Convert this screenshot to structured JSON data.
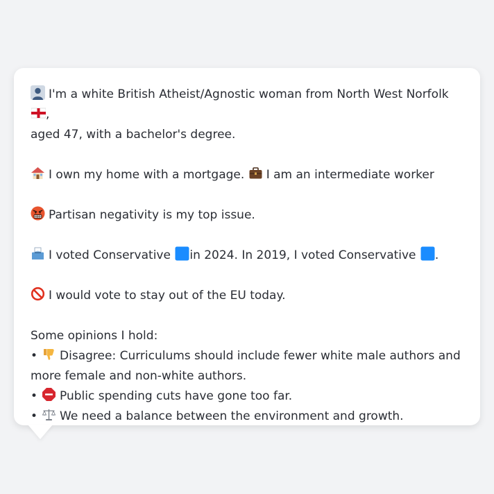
{
  "profile": {
    "identity": {
      "icon": "person-silhouette-icon",
      "text": "I'm a white British Atheist/Agnostic woman from North West Norfolk",
      "flag_icon": "england-flag-icon",
      "suffix": ",",
      "line2": "aged 47, with a bachelor's degree."
    },
    "housing": {
      "icon": "house-icon",
      "text": "I own my home with a mortgage.",
      "work_icon": "briefcase-icon",
      "work_text": "I am an intermediate worker"
    },
    "issue": {
      "icon": "angry-face-icon",
      "text": "Partisan negativity is my top issue."
    },
    "vote": {
      "icon": "ballot-box-icon",
      "text_a": "I voted Conservative",
      "party_icon": "blue-square-icon",
      "text_b": "in 2024. In 2019, I voted Conservative",
      "suffix": "."
    },
    "eu": {
      "icon": "prohibited-icon",
      "text": "I would vote to stay out of the EU today."
    },
    "opinions": {
      "heading": "Some opinions I hold:",
      "items": [
        {
          "bullet": "•",
          "icon": "thumbs-down-icon",
          "text_line1": "Disagree: Curriculums should include fewer white male authors and",
          "text_line2": "more female and non-white authors."
        },
        {
          "bullet": "•",
          "icon": "stop-sign-icon",
          "text_line1": "Public spending cuts have gone too far.",
          "text_line2": ""
        },
        {
          "bullet": "•",
          "icon": "balance-scale-icon",
          "text_line1": "We need a balance between the environment and growth.",
          "text_line2": ""
        }
      ]
    }
  },
  "colors": {
    "background": "#f2f3f5",
    "bubble": "#ffffff",
    "text": "#2a2d34",
    "conservative_blue": "#1a8cff"
  }
}
